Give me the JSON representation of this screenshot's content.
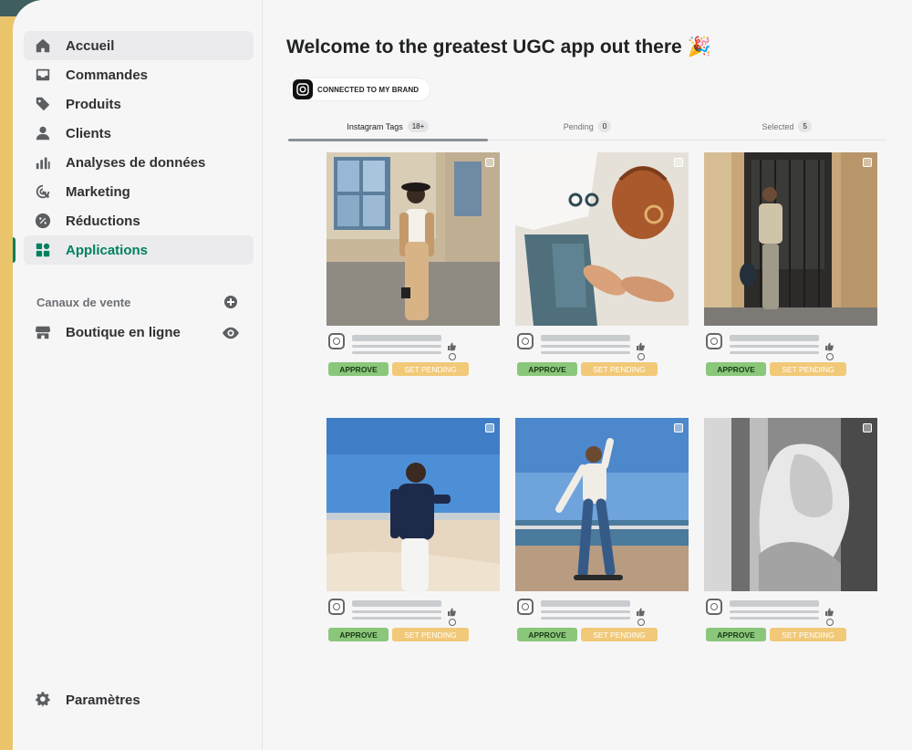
{
  "nav": {
    "items": [
      {
        "label": "Accueil",
        "icon": "home-icon"
      },
      {
        "label": "Commandes",
        "icon": "inbox-icon"
      },
      {
        "label": "Produits",
        "icon": "tag-icon"
      },
      {
        "label": "Clients",
        "icon": "person-icon"
      },
      {
        "label": "Analyses de données",
        "icon": "bar-chart-icon"
      },
      {
        "label": "Marketing",
        "icon": "target-icon"
      },
      {
        "label": "Réductions",
        "icon": "discount-icon"
      },
      {
        "label": "Applications",
        "icon": "apps-icon"
      }
    ],
    "active_index": 7
  },
  "sales_channels": {
    "title": "Canaux de vente",
    "store_label": "Boutique en ligne"
  },
  "settings_label": "Paramètres",
  "main": {
    "title": "Welcome to the greatest UGC app out there 🎉",
    "brand_badge": "CONNECTED TO MY BRAND",
    "tabs": [
      {
        "label": "Instagram Tags",
        "count": "18+"
      },
      {
        "label": "Pending",
        "count": "0"
      },
      {
        "label": "Selected",
        "count": "5"
      }
    ],
    "active_tab": 0
  },
  "cards": [
    {
      "approve": "APPROVE",
      "pending": "SET PENDING"
    },
    {
      "approve": "APPROVE",
      "pending": "SET PENDING"
    },
    {
      "approve": "APPROVE",
      "pending": "SET PENDING"
    },
    {
      "approve": "APPROVE",
      "pending": "SET PENDING"
    },
    {
      "approve": "APPROVE",
      "pending": "SET PENDING"
    },
    {
      "approve": "APPROVE",
      "pending": "SET PENDING"
    }
  ],
  "colors": {
    "accent": "#008060",
    "approve": "#8ac77a",
    "pending": "#f1c978",
    "sidebar_bg": "#f6f6f7"
  }
}
